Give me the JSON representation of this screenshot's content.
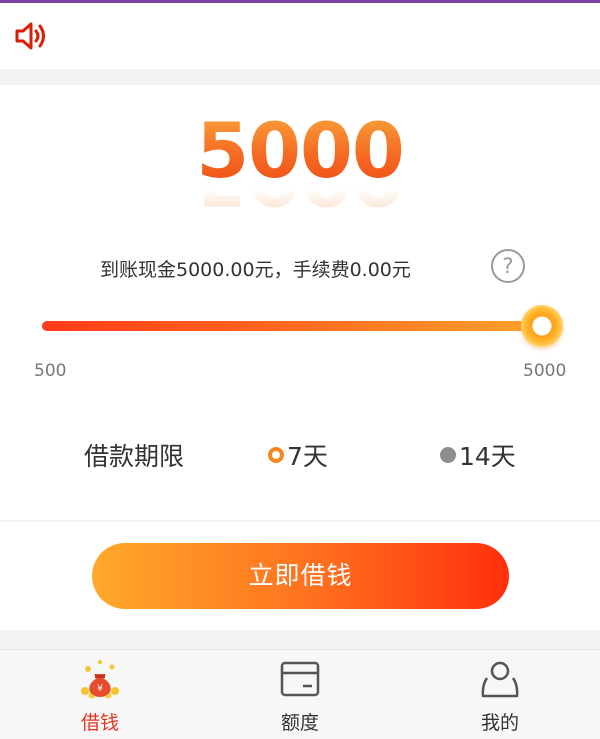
{
  "notice": {
    "icon": "speaker-icon",
    "color": "#d81e06"
  },
  "loan": {
    "amount": "5000",
    "description": "到账现金5000.00元，手续费0.00元",
    "help_icon": "?"
  },
  "slider": {
    "min_label": "500",
    "max_label": "5000",
    "value_fraction": 1.0
  },
  "term": {
    "label": "借款期限",
    "options": [
      {
        "label": "7天",
        "selected": true
      },
      {
        "label": "14天",
        "selected": false
      }
    ]
  },
  "action": {
    "button_label": "立即借钱"
  },
  "tabbar": {
    "items": [
      {
        "label": "借钱",
        "icon": "money-bag-icon",
        "active": true
      },
      {
        "label": "额度",
        "icon": "card-icon",
        "active": false
      },
      {
        "label": "我的",
        "icon": "user-icon",
        "active": false
      }
    ]
  },
  "colors": {
    "accent": "#ff6a1f",
    "active_tab": "#e5351f",
    "top_strip": "#7b3fa6"
  }
}
